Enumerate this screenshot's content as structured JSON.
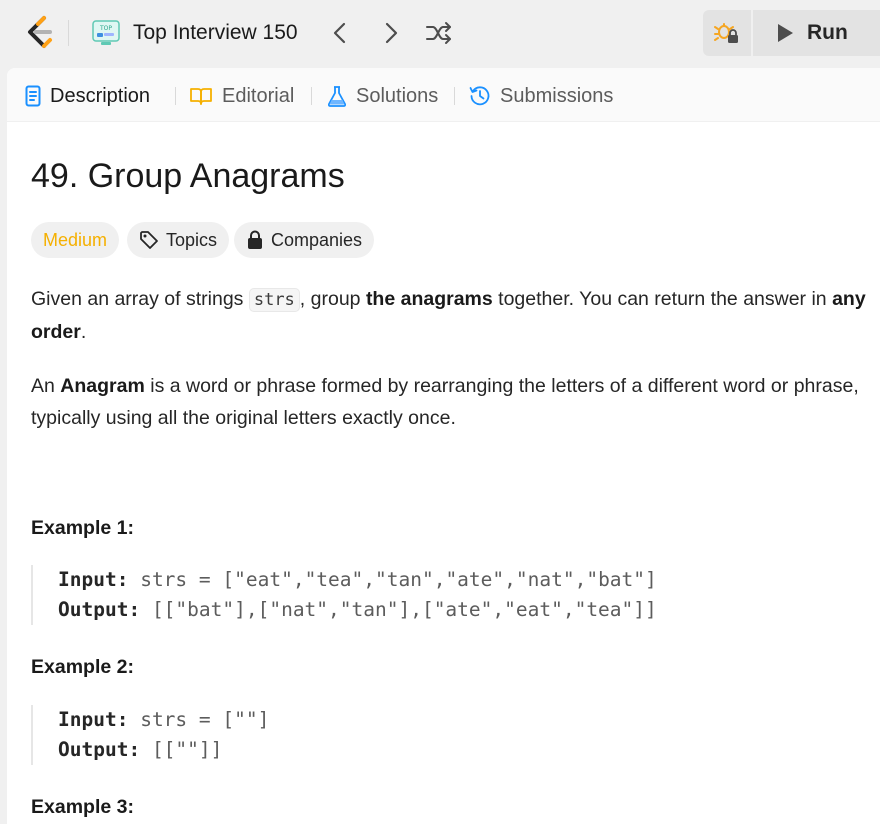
{
  "topbar": {
    "list_title": "Top Interview 150",
    "list_badge": "TOP",
    "run_label": "Run",
    "colors": {
      "logo_orange": "#FFA116",
      "logo_dark": "#262626",
      "debug_orange": "#f5a623"
    },
    "icons": {
      "logo": "leetcode-logo-icon",
      "list": "study-plan-icon",
      "prev": "chevron-left-icon",
      "next": "chevron-right-icon",
      "shuffle": "shuffle-icon",
      "debug": "debug-locked-icon",
      "run": "play-icon"
    }
  },
  "tabs": [
    {
      "label": "Description",
      "icon": "document-icon",
      "active": true
    },
    {
      "label": "Editorial",
      "icon": "book-icon",
      "active": false
    },
    {
      "label": "Solutions",
      "icon": "flask-icon",
      "active": false
    },
    {
      "label": "Submissions",
      "icon": "history-icon",
      "active": false
    }
  ],
  "problem": {
    "title": "49. Group Anagrams",
    "difficulty": "Medium",
    "difficulty_color": "#f5b000",
    "topics_label": "Topics",
    "companies_label": "Companies",
    "desc1": {
      "t1": "Given an array of strings ",
      "code": "strs",
      "t2": ", group ",
      "b1": "the anagrams",
      "t3": " together. You can return the answer in ",
      "b2": "any order",
      "t4": "."
    },
    "desc2": {
      "t1": "An ",
      "b1": "Anagram",
      "t2": " is a word or phrase formed by rearranging the letters of a different word or phrase, typically using all the original letters exactly once."
    },
    "examples": [
      {
        "heading": "Example 1:",
        "input_label": "Input:",
        "input_value": "strs = [\"eat\",\"tea\",\"tan\",\"ate\",\"nat\",\"bat\"]",
        "output_label": "Output:",
        "output_value": "[[\"bat\"],[\"nat\",\"tan\"],[\"ate\",\"eat\",\"tea\"]]"
      },
      {
        "heading": "Example 2:",
        "input_label": "Input:",
        "input_value": "strs = [\"\"]",
        "output_label": "Output:",
        "output_value": "[[\"\"]]"
      },
      {
        "heading": "Example 3:"
      }
    ]
  }
}
